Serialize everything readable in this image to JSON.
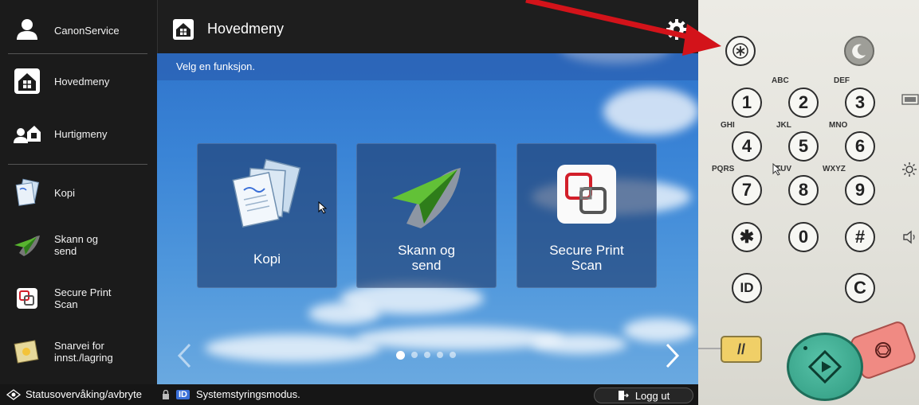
{
  "sidebar": {
    "items": [
      {
        "label": "CanonService",
        "icon": "user-icon"
      },
      {
        "label": "Hovedmeny",
        "icon": "home-icon"
      },
      {
        "label": "Hurtigmeny",
        "icon": "quick-menu-icon"
      },
      {
        "label": "Kopi",
        "icon": "copy-icon"
      },
      {
        "label": "Skann og\nsend",
        "icon": "scan-send-icon"
      },
      {
        "label": "Secure Print\nScan",
        "icon": "secure-print-icon"
      },
      {
        "label": "Snarvei for\ninnst./lagring",
        "icon": "shortcut-icon"
      }
    ]
  },
  "header": {
    "title": "Hovedmeny"
  },
  "subbar": {
    "text": "Velg en funksjon."
  },
  "tiles": [
    {
      "label": "Kopi"
    },
    {
      "label": "Skann og\nsend"
    },
    {
      "label": "Secure Print\nScan"
    }
  ],
  "pager": {
    "pages": 5,
    "current": 1
  },
  "statusbar": {
    "status_label": "Statusovervåking/avbryte",
    "system_label": "Systemstyringsmodus.",
    "id_badge": "ID",
    "logout_label": "Logg ut"
  },
  "keypad": {
    "keys": [
      "1",
      "2",
      "3",
      "4",
      "5",
      "6",
      "7",
      "8",
      "9",
      "✱",
      "0",
      "#",
      "ID",
      "C"
    ],
    "letters": [
      "ABC",
      "DEF",
      "GHI",
      "JKL",
      "MNO",
      "PQRS",
      "TUV",
      "WXYZ"
    ],
    "reset_label": "//"
  },
  "colors": {
    "accent": "#3a6fd8",
    "arrow": "#d3131a",
    "start": "#3aa98c",
    "stop": "#f08a83",
    "reset": "#f0cf67"
  }
}
